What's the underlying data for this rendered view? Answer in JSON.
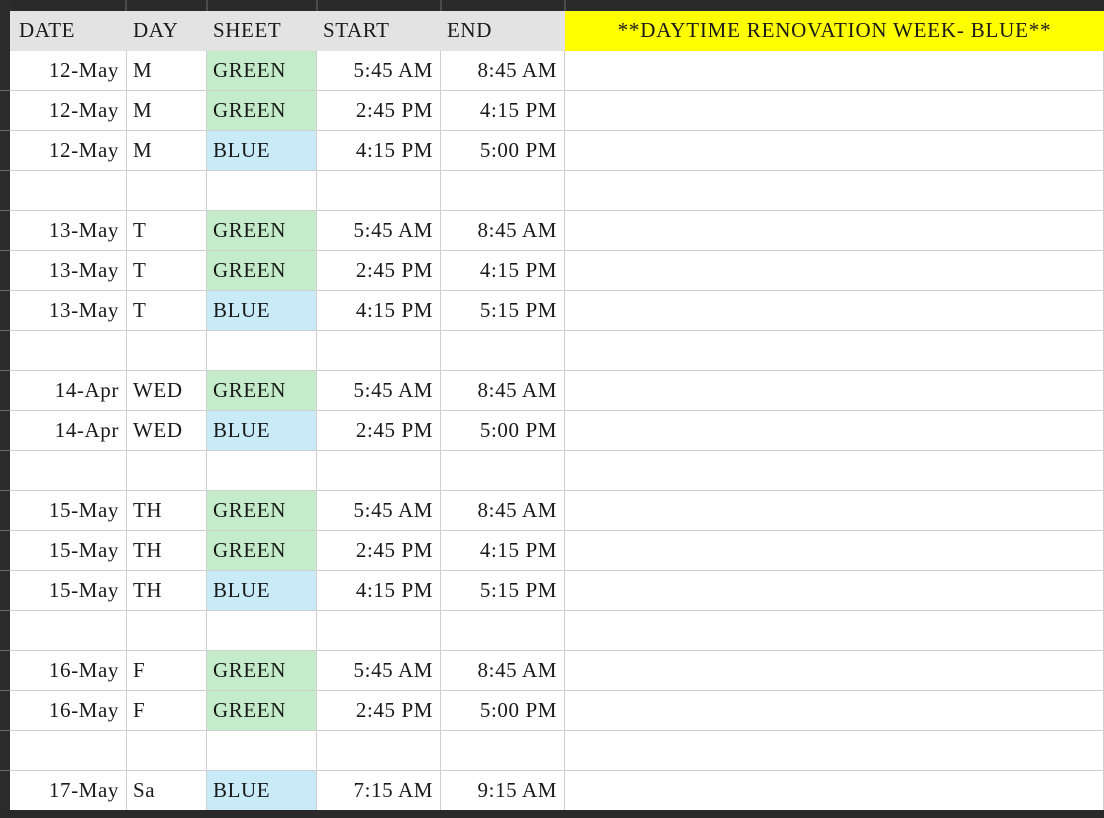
{
  "header": {
    "date": "DATE",
    "day": "DAY",
    "sheet": "SHEET",
    "start": "START",
    "end": "END",
    "banner": "**DAYTIME RENOVATION WEEK- BLUE**"
  },
  "colors": {
    "green_fill": "#c5ecca",
    "blue_fill": "#c9eaf7",
    "banner_fill": "#ffff00",
    "header_fill": "#e3e3e3"
  },
  "rows": [
    {
      "date": "12-May",
      "day": "M",
      "sheet": "GREEN",
      "start": "5:45 AM",
      "end": "8:45 AM"
    },
    {
      "date": "12-May",
      "day": "M",
      "sheet": "GREEN",
      "start": "2:45 PM",
      "end": "4:15 PM"
    },
    {
      "date": "12-May",
      "day": "M",
      "sheet": "BLUE",
      "start": "4:15 PM",
      "end": "5:00 PM"
    },
    {
      "date": "",
      "day": "",
      "sheet": "",
      "start": "",
      "end": ""
    },
    {
      "date": "13-May",
      "day": "T",
      "sheet": "GREEN",
      "start": "5:45 AM",
      "end": "8:45 AM"
    },
    {
      "date": "13-May",
      "day": "T",
      "sheet": "GREEN",
      "start": "2:45 PM",
      "end": "4:15 PM"
    },
    {
      "date": "13-May",
      "day": "T",
      "sheet": "BLUE",
      "start": "4:15 PM",
      "end": "5:15 PM"
    },
    {
      "date": "",
      "day": "",
      "sheet": "",
      "start": "",
      "end": ""
    },
    {
      "date": "14-Apr",
      "day": "WED",
      "sheet": "GREEN",
      "start": "5:45 AM",
      "end": "8:45 AM"
    },
    {
      "date": "14-Apr",
      "day": "WED",
      "sheet": "BLUE",
      "start": "2:45 PM",
      "end": "5:00 PM"
    },
    {
      "date": "",
      "day": "",
      "sheet": "",
      "start": "",
      "end": ""
    },
    {
      "date": "15-May",
      "day": "TH",
      "sheet": "GREEN",
      "start": "5:45 AM",
      "end": "8:45 AM"
    },
    {
      "date": "15-May",
      "day": "TH",
      "sheet": "GREEN",
      "start": "2:45 PM",
      "end": "4:15 PM"
    },
    {
      "date": "15-May",
      "day": "TH",
      "sheet": "BLUE",
      "start": "4:15 PM",
      "end": "5:15 PM"
    },
    {
      "date": "",
      "day": "",
      "sheet": "",
      "start": "",
      "end": ""
    },
    {
      "date": "16-May",
      "day": "F",
      "sheet": "GREEN",
      "start": "5:45 AM",
      "end": "8:45 AM"
    },
    {
      "date": "16-May",
      "day": "F",
      "sheet": "GREEN",
      "start": "2:45 PM",
      "end": "5:00 PM"
    },
    {
      "date": "",
      "day": "",
      "sheet": "",
      "start": "",
      "end": ""
    },
    {
      "date": "17-May",
      "day": "Sa",
      "sheet": "BLUE",
      "start": "7:15 AM",
      "end": "9:15 AM"
    }
  ]
}
